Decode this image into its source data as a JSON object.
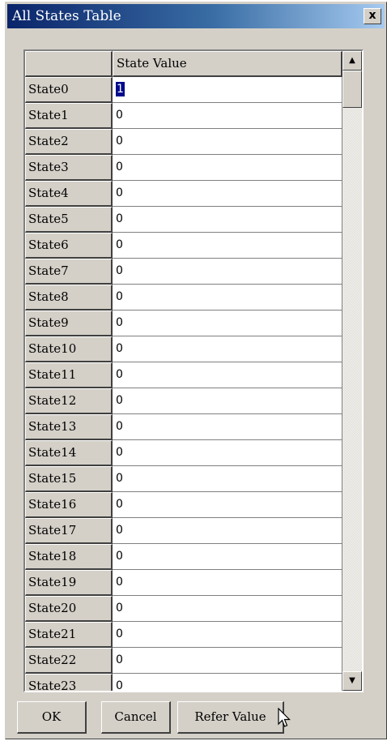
{
  "window": {
    "title": "All States Table",
    "close_label": "x"
  },
  "table": {
    "column_header": "State Value",
    "rows": [
      {
        "label": "State0",
        "value": "1"
      },
      {
        "label": "State1",
        "value": "0"
      },
      {
        "label": "State2",
        "value": "0"
      },
      {
        "label": "State3",
        "value": "0"
      },
      {
        "label": "State4",
        "value": "0"
      },
      {
        "label": "State5",
        "value": "0"
      },
      {
        "label": "State6",
        "value": "0"
      },
      {
        "label": "State7",
        "value": "0"
      },
      {
        "label": "State8",
        "value": "0"
      },
      {
        "label": "State9",
        "value": "0"
      },
      {
        "label": "State10",
        "value": "0"
      },
      {
        "label": "State11",
        "value": "0"
      },
      {
        "label": "State12",
        "value": "0"
      },
      {
        "label": "State13",
        "value": "0"
      },
      {
        "label": "State14",
        "value": "0"
      },
      {
        "label": "State15",
        "value": "0"
      },
      {
        "label": "State16",
        "value": "0"
      },
      {
        "label": "State17",
        "value": "0"
      },
      {
        "label": "State18",
        "value": "0"
      },
      {
        "label": "State19",
        "value": "0"
      },
      {
        "label": "State20",
        "value": "0"
      },
      {
        "label": "State21",
        "value": "0"
      },
      {
        "label": "State22",
        "value": "0"
      },
      {
        "label": "State23",
        "value": "0"
      }
    ]
  },
  "scrollbar": {
    "up_icon": "▲",
    "down_icon": "▼"
  },
  "buttons": {
    "ok": "OK",
    "cancel": "Cancel",
    "refer": "Refer Value"
  }
}
